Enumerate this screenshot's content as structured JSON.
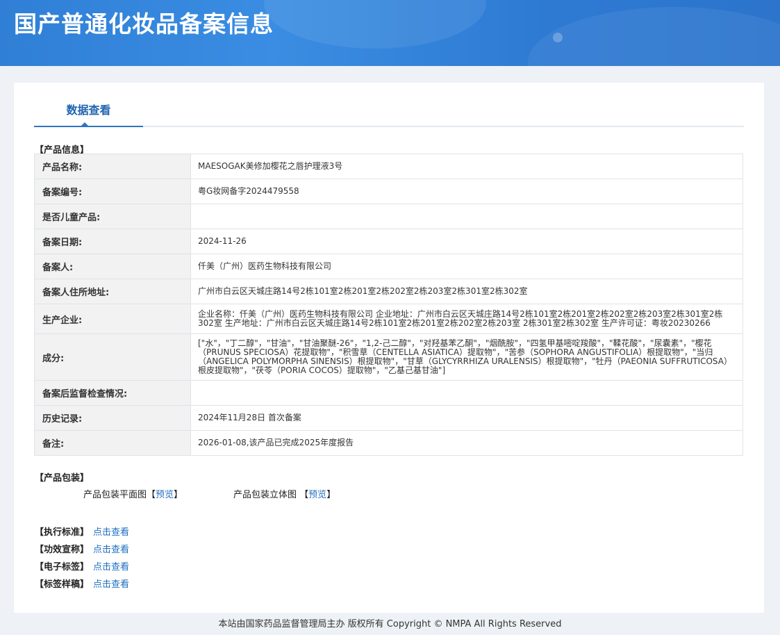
{
  "header": {
    "title": "国产普通化妆品备案信息"
  },
  "tab": {
    "label": "数据查看"
  },
  "product_info": {
    "section_title": "【产品信息】",
    "rows": [
      {
        "label": "产品名称:",
        "value": "MAESOGAK美修加樱花之唇护理液3号"
      },
      {
        "label": "备案编号:",
        "value": "粤G妆网备字2024479558"
      },
      {
        "label": "是否儿童产品:",
        "value": ""
      },
      {
        "label": "备案日期:",
        "value": "2024-11-26"
      },
      {
        "label": "备案人:",
        "value": "仟美（广州）医药生物科技有限公司"
      },
      {
        "label": "备案人住所地址:",
        "value": "广州市白云区天城庄路14号2栋101室2栋201室2栋202室2栋203室2栋301室2栋302室"
      },
      {
        "label": "生产企业:",
        "value": "企业名称：仟美（广州）医药生物科技有限公司 企业地址：广州市白云区天城庄路14号2栋101室2栋201室2栋202室2栋203室2栋301室2栋302室 生产地址：广州市白云区天城庄路14号2栋101室2栋201室2栋202室2栋203室 2栋301室2栋302室 生产许可证：粤妆20230266"
      },
      {
        "label": "成分:",
        "value": "[\"水\"，\"丁二醇\"，\"甘油\"，\"甘油聚醚-26\"，\"1,2-己二醇\"，\"对羟基苯乙酮\"，\"烟酰胺\"，\"四氢甲基嘧啶羧酸\"，\"鞣花酸\"，\"尿囊素\"，\"樱花（PRUNUS SPECIOSA）花提取物\"，\"积雪草（CENTELLA ASIATICA）提取物\"，\"苦参（SOPHORA ANGUSTIFOLIA）根提取物\"，\"当归（ANGELICA POLYMORPHA SINENSIS）根提取物\"，\"甘草（GLYCYRRHIZA URALENSIS）根提取物\"，\"牡丹（PAEONIA SUFFRUTICOSA）根皮提取物\"，\"茯苓（PORIA COCOS）提取物\"，\"乙基己基甘油\"]"
      },
      {
        "label": "备案后监督检查情况:",
        "value": ""
      },
      {
        "label": "历史记录:",
        "value": "2024年11月28日 首次备案"
      },
      {
        "label": "备注:",
        "value": "2026-01-08,该产品已完成2025年度报告"
      }
    ]
  },
  "packaging": {
    "section_title": "【产品包装】",
    "flat_label": "产品包装平面图",
    "solid_label": "产品包装立体图",
    "bracket_open": "【",
    "bracket_close": "】",
    "preview_link": "预览"
  },
  "extras": [
    {
      "label": "【执行标准】",
      "link": "点击查看"
    },
    {
      "label": "【功效宣称】",
      "link": "点击查看"
    },
    {
      "label": "【电子标签】",
      "link": "点击查看"
    },
    {
      "label": "【标签样稿】",
      "link": "点击查看"
    }
  ],
  "footer": {
    "text": "本站由国家药品监督管理局主办 版权所有 Copyright © NMPA All Rights Reserved"
  }
}
